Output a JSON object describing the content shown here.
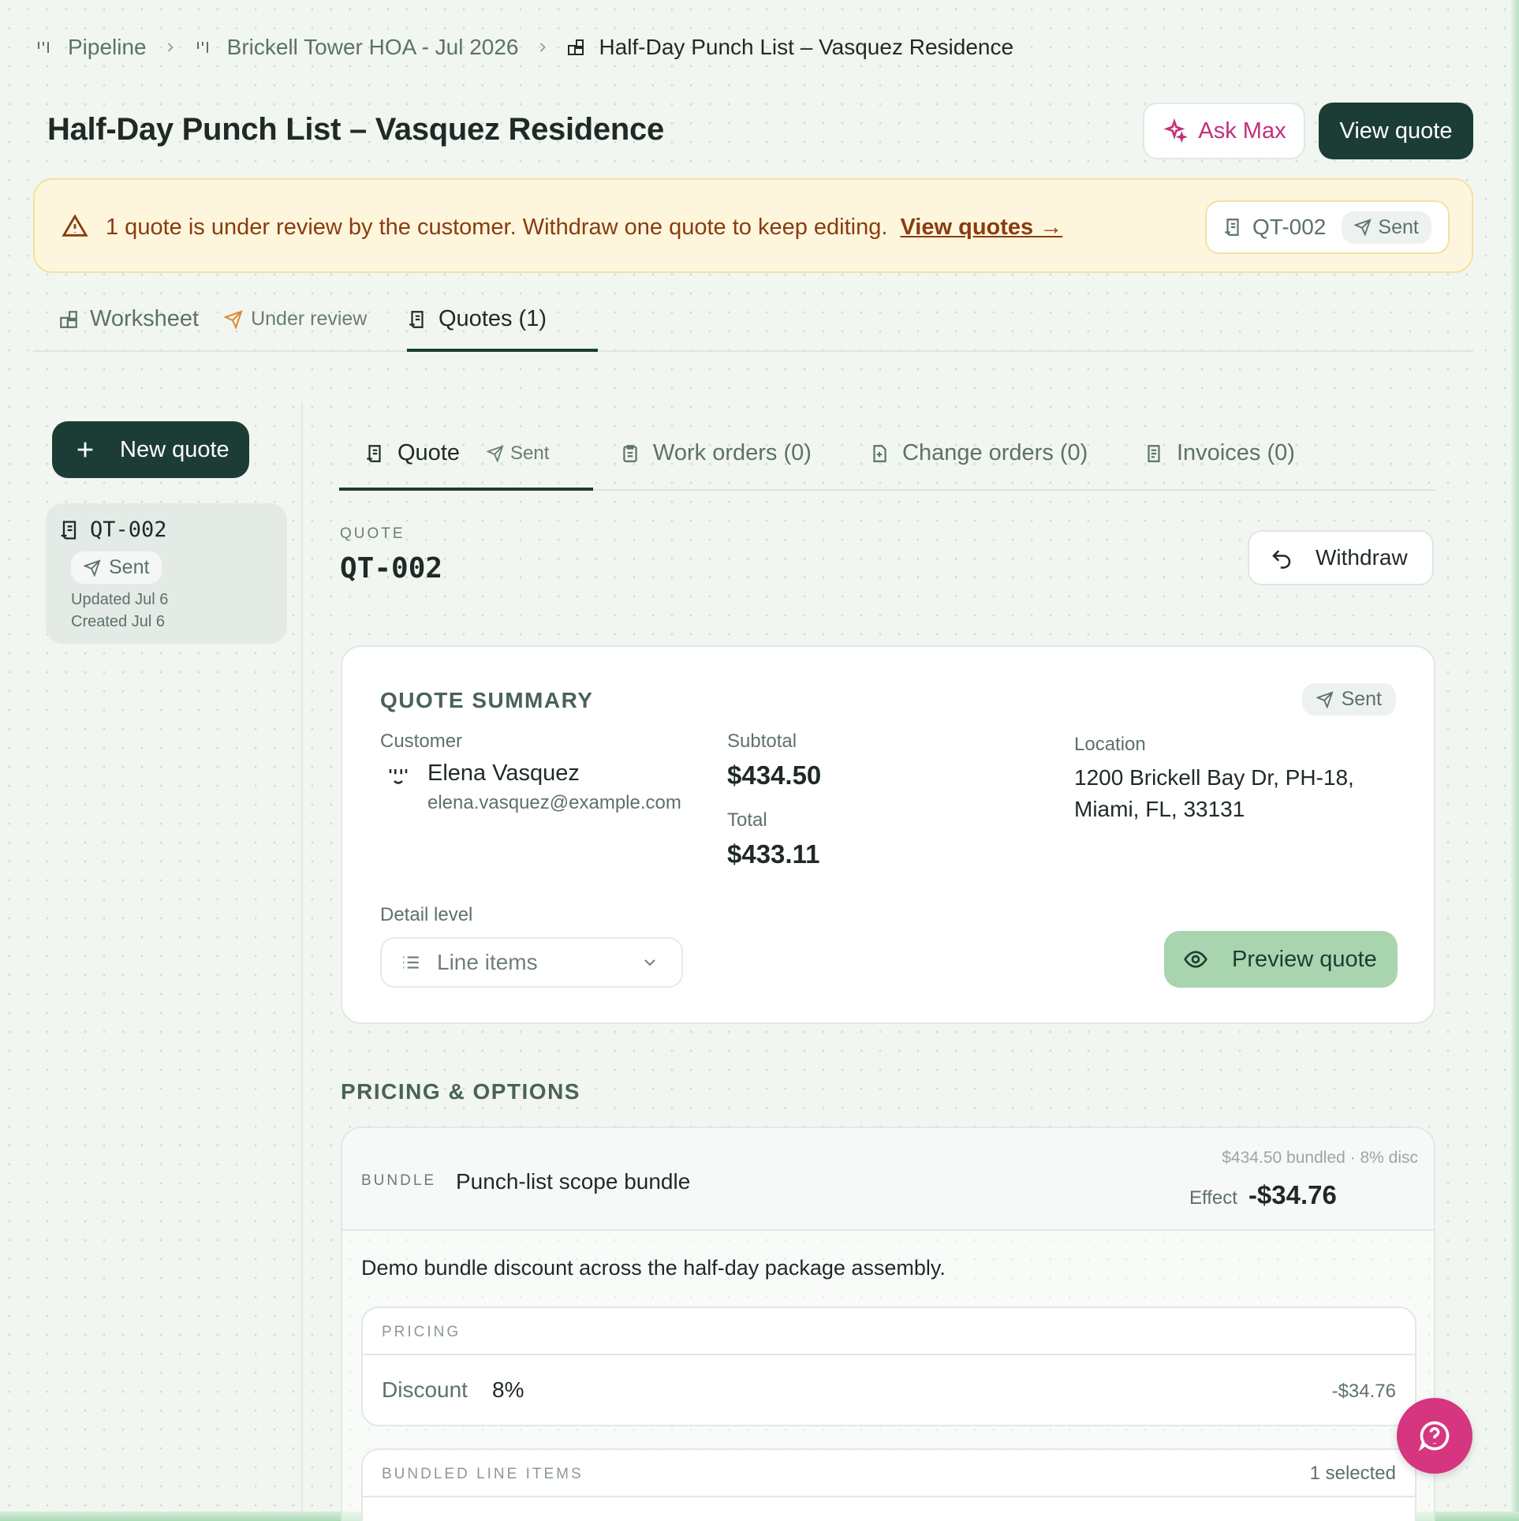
{
  "breadcrumb": {
    "items": [
      "Pipeline",
      "Brickell Tower HOA - Jul 2026",
      "Half-Day Punch List – Vasquez Residence"
    ]
  },
  "header": {
    "title": "Half-Day Punch List – Vasquez Residence",
    "ask_label": "Ask Max",
    "view_quote_label": "View quote"
  },
  "banner": {
    "message": "1 quote is under review by the customer. Withdraw one quote to keep editing.",
    "link": "View quotes →",
    "quote_id": "QT-002",
    "status": "Sent"
  },
  "top_tabs": {
    "worksheet": "Worksheet",
    "worksheet_status": "Under review",
    "quotes": "Quotes (1)"
  },
  "sidebar": {
    "new_quote_label": "New quote",
    "quote_card": {
      "id": "QT-002",
      "status": "Sent",
      "updated": "Updated Jul 6",
      "created": "Created Jul 6"
    }
  },
  "sub_tabs": {
    "quote": "Quote",
    "quote_status": "Sent",
    "work_orders": "Work orders (0)",
    "change_orders": "Change orders (0)",
    "invoices": "Invoices (0)"
  },
  "quote": {
    "eyebrow": "QUOTE",
    "number": "QT-002",
    "withdraw_label": "Withdraw"
  },
  "summary": {
    "heading": "QUOTE SUMMARY",
    "status": "Sent",
    "customer_label": "Customer",
    "customer_name": "Elena Vasquez",
    "customer_email": "elena.vasquez@example.com",
    "subtotal_label": "Subtotal",
    "subtotal": "$434.50",
    "total_label": "Total",
    "total": "$433.11",
    "location_label": "Location",
    "location_line1": "1200 Brickell Bay Dr, PH-18,",
    "location_line2": "Miami, FL, 33131",
    "detail_label": "Detail level",
    "detail_value": "Line items",
    "preview_label": "Preview quote"
  },
  "pricing": {
    "heading": "PRICING & OPTIONS",
    "bundle": {
      "eyebrow": "BUNDLE",
      "name": "Punch-list scope bundle",
      "meta": "$434.50 bundled · 8% disc",
      "effect_label": "Effect",
      "effect_value": "-$34.76",
      "description": "Demo bundle discount across the half-day package assembly.",
      "pricing_heading": "PRICING",
      "discount_label": "Discount",
      "discount_value": "8%",
      "discount_amount": "-$34.76",
      "bundled_heading": "BUNDLED LINE ITEMS",
      "selected_count": "1 selected"
    }
  },
  "colors": {
    "brand_dark": "#1c3d36",
    "accent_pink": "#d6357f",
    "warning_text": "#8a3b10",
    "preview_green": "#a9d5ae"
  },
  "icons": [
    "bar-chart-icon",
    "chevron-right-icon",
    "layout-grid-icon",
    "sparkle-icon",
    "warning-icon",
    "receipt-icon",
    "send-icon",
    "plus-icon",
    "clipboard-icon",
    "file-plus-icon",
    "file-text-icon",
    "undo-icon",
    "face-icon",
    "list-icon",
    "chevron-down-icon",
    "eye-icon",
    "help-icon"
  ]
}
